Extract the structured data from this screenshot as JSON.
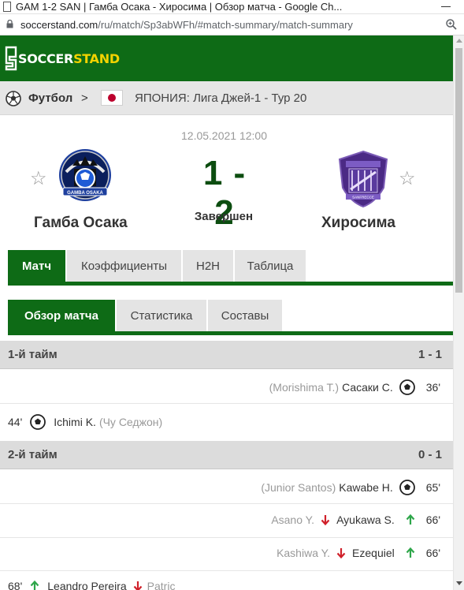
{
  "browser": {
    "title": "GAM 1-2 SAN | Гамба Осака - Хиросима | Обзор матча - Google Ch...",
    "url_host": "soccerstand.com",
    "url_path": "/ru/match/Sp3abWFh/#match-summary/match-summary",
    "icons": [
      "page-icon",
      "lock-icon",
      "zoom-icon",
      "minimize-icon"
    ]
  },
  "site": {
    "logo_part1": "S",
    "logo_part2": "OCCER",
    "logo_part3": "STAND",
    "brand_green": "#0e6b16",
    "brand_yellow": "#f3d300"
  },
  "breadcrumb": {
    "sport": "Футбол",
    "separator": ">",
    "league": "ЯПОНИЯ: Лига Джей-1 - Тур 20"
  },
  "match": {
    "datetime": "12.05.2021 12:00",
    "home_team": "Гамба Осака",
    "away_team": "Хиросима",
    "score": "1 - 2",
    "status": "Завершен",
    "crest_home_text": "GAMBA OSAKA",
    "crest_away_text": "SANFRECCE"
  },
  "tabs_main": [
    "Матч",
    "Коэффициенты",
    "H2H",
    "Таблица"
  ],
  "tabs_sub": [
    "Обзор матча",
    "Статистика",
    "Составы"
  ],
  "summary": {
    "periods": [
      {
        "name": "1-й тайм",
        "score": "1 - 1",
        "events": [
          {
            "side": "away",
            "type": "goal",
            "assist": "(Morishima T.)",
            "player": "Сасаки С.",
            "minute": "36'"
          },
          {
            "side": "home",
            "type": "goal",
            "minute": "44'",
            "player": "Ichimi K.",
            "assist": "(Чу Седжон)"
          }
        ]
      },
      {
        "name": "2-й тайм",
        "score": "0 - 1",
        "events": [
          {
            "side": "away",
            "type": "goal",
            "assist": "(Junior Santos)",
            "player": "Kawabe H.",
            "minute": "65'"
          },
          {
            "side": "away",
            "type": "substitution",
            "out": "Asano Y.",
            "in": "Ayukawa S.",
            "minute": "66'"
          },
          {
            "side": "away",
            "type": "substitution",
            "out": "Kashiwa Y.",
            "in": "Ezequiel",
            "minute": "66'"
          },
          {
            "side": "home",
            "type": "substitution",
            "minute": "68'",
            "in": "Leandro Pereira",
            "out": "Patric"
          }
        ]
      }
    ]
  },
  "colors": {
    "arrow_in": "#2ea64a",
    "arrow_out": "#d0202a",
    "score_color": "#0c4d10"
  }
}
